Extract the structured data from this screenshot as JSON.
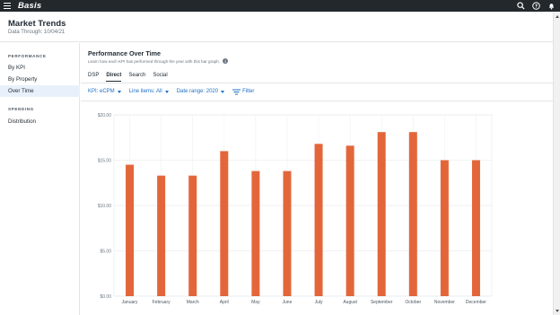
{
  "app": {
    "logo": "Basis"
  },
  "topbar": {
    "icons": [
      "search-icon",
      "help-icon",
      "bell-icon"
    ]
  },
  "header": {
    "title": "Market Trends",
    "data_through": "Data Through: 10/04/21"
  },
  "sidebar": {
    "sections": [
      {
        "label": "PERFORMANCE",
        "items": [
          {
            "label": "By KPI"
          },
          {
            "label": "By Property"
          },
          {
            "label": "Over Time",
            "active": true
          }
        ]
      },
      {
        "label": "SPENDING",
        "items": [
          {
            "label": "Distribution"
          }
        ]
      }
    ]
  },
  "main": {
    "title": "Performance Over Time",
    "subtitle": "Learn how each KPI has performed through the year with this bar graph.",
    "tabs": [
      {
        "label": "DSP"
      },
      {
        "label": "Direct",
        "active": true
      },
      {
        "label": "Search"
      },
      {
        "label": "Social"
      }
    ],
    "filters": {
      "kpi": "KPI: eCPM",
      "line_items": "Line items: All",
      "date_range": "Date range: 2020",
      "filter": "Filter"
    }
  },
  "colors": {
    "bar": "#e3663b",
    "accent": "#1f6fc4",
    "topbar": "#23282c"
  },
  "chart_data": {
    "type": "bar",
    "categories": [
      "January",
      "February",
      "March",
      "April",
      "May",
      "June",
      "July",
      "August",
      "September",
      "October",
      "November",
      "December"
    ],
    "values": [
      14.5,
      13.3,
      13.3,
      16.0,
      13.8,
      13.8,
      16.8,
      16.6,
      18.1,
      18.1,
      15.0,
      15.0
    ],
    "yticks": [
      "$0.00",
      "$5.00",
      "$10.00",
      "$15.00",
      "$20.00"
    ],
    "ylim": [
      0,
      20
    ],
    "grid": true
  }
}
